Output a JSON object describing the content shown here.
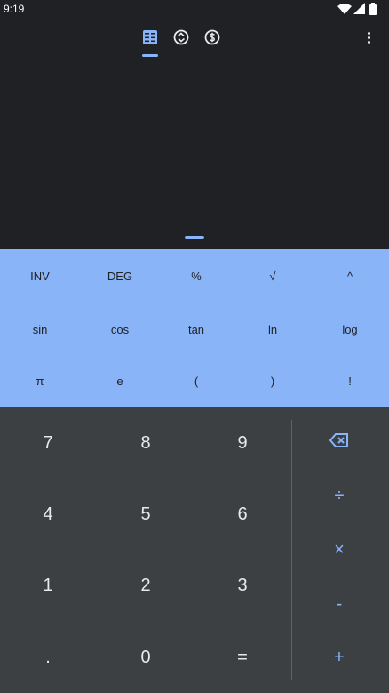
{
  "status_bar": {
    "time": "9:19"
  },
  "tabs": [
    {
      "name": "calculator",
      "active": true
    },
    {
      "name": "unit-converter",
      "active": false
    },
    {
      "name": "currency-converter",
      "active": false
    }
  ],
  "display": {
    "expression": "",
    "result": ""
  },
  "scientific": {
    "row1": [
      "INV",
      "DEG",
      "%",
      "√",
      "^"
    ],
    "row2": [
      "sin",
      "cos",
      "tan",
      "ln",
      "log"
    ],
    "row3": [
      "π",
      "e",
      "(",
      ")",
      "!"
    ]
  },
  "keypad": {
    "rows": [
      [
        "7",
        "8",
        "9"
      ],
      [
        "4",
        "5",
        "6"
      ],
      [
        "1",
        "2",
        "3"
      ],
      [
        ".",
        "0",
        "="
      ]
    ]
  },
  "operators": {
    "divide": "÷",
    "multiply": "×",
    "minus": "-",
    "plus": "+"
  },
  "colors": {
    "background": "#202124",
    "accent": "#8ab4f8",
    "keypad_background": "#3c4043",
    "key_text": "#e8eaed"
  }
}
